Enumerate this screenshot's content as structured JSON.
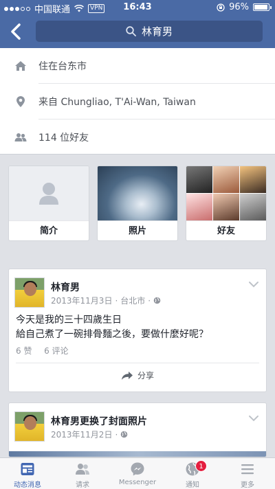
{
  "status_bar": {
    "carrier": "中国联通",
    "vpn": "VPN",
    "time": "16:43",
    "battery": "96%",
    "battery_level": 0.96
  },
  "header": {
    "search_text": "林育男"
  },
  "info": {
    "lives_in": "住在台东市",
    "from": "来自 Chungliao, T'Ai-Wan, Taiwan",
    "friends": "114 位好友"
  },
  "tiles": [
    {
      "label": "简介"
    },
    {
      "label": "照片"
    },
    {
      "label": "好友"
    }
  ],
  "posts": [
    {
      "author": "林育男",
      "date": "2013年11月3日",
      "location": "台北市",
      "separator": "·",
      "body_line1": "今天是我的三十四歲生日",
      "body_line2": "給自己煮了一碗排骨麵之後，要做什麼好呢？",
      "likes": "6 赞",
      "comments": "6 评论",
      "share": "分享"
    },
    {
      "author": "林育男",
      "action": "更换了封面照片",
      "date": "2013年11月2日",
      "separator": "·"
    }
  ],
  "tabbar": [
    {
      "label": "动态消息",
      "icon": "news-feed-icon",
      "active": true
    },
    {
      "label": "请求",
      "icon": "friend-requests-icon"
    },
    {
      "label": "Messenger",
      "icon": "messenger-icon"
    },
    {
      "label": "通知",
      "icon": "globe-notifications-icon",
      "badge": "1"
    },
    {
      "label": "更多",
      "icon": "menu-icon"
    }
  ],
  "colors": {
    "brand": "#4a6aa5",
    "accent": "#4267b2",
    "badge": "#e41e3f"
  }
}
